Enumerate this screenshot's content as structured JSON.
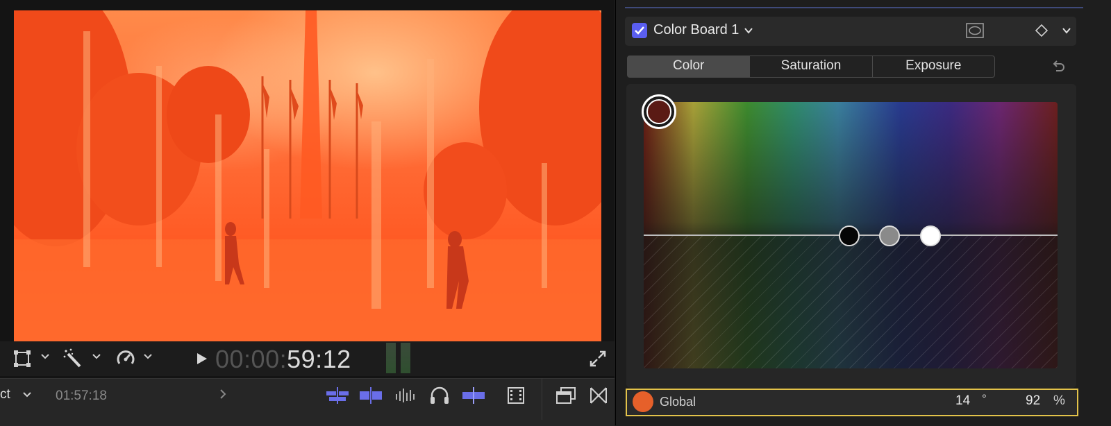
{
  "viewer": {
    "timecode_dim": "00:00:",
    "timecode_bright": "59:12",
    "timeline_left_label": "ct",
    "timeline_duration": "01:57:18"
  },
  "inspector": {
    "effect_name": "Color Board 1",
    "effect_enabled": true,
    "tabs": [
      {
        "label": "Color",
        "active": true
      },
      {
        "label": "Saturation",
        "active": false
      },
      {
        "label": "Exposure",
        "active": false
      }
    ],
    "global": {
      "label": "Global",
      "angle_value": "14",
      "angle_unit": "°",
      "amount_value": "92",
      "amount_unit": "%",
      "swatch_color": "#e6602a"
    }
  },
  "colors": {
    "accent": "#5a5ef0",
    "highlight_border": "#e3c34a",
    "timeline_icon_blue": "#6a6ee8"
  },
  "icons": [
    "transform-icon",
    "magic-wand-icon",
    "speed-icon",
    "play-icon",
    "expand-icon",
    "chevron-right-icon",
    "snapping-icon",
    "skimming-icon",
    "audio-skimming-icon",
    "headphones-icon",
    "solo-icon",
    "clip-appearance-icon",
    "window-icon",
    "transition-icon",
    "mask-icon",
    "keyframe-icon",
    "reset-icon"
  ]
}
